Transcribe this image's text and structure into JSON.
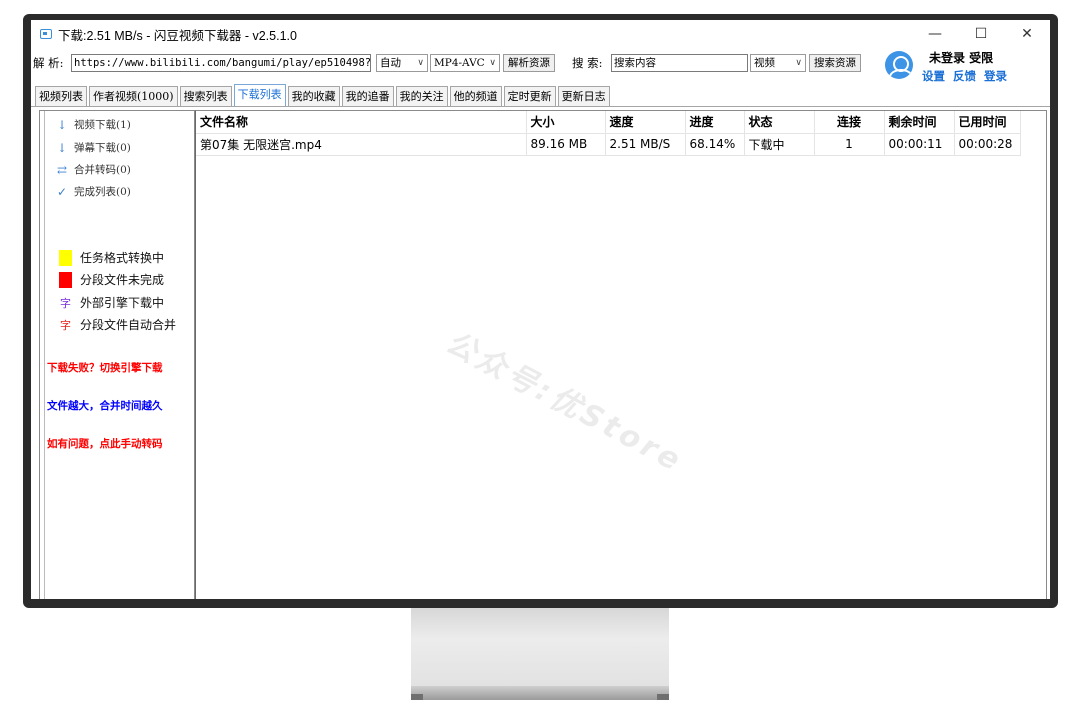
{
  "window": {
    "title": "下载:2.51 MB/s - 闪豆视频下载器 - v2.5.1.0",
    "minimize": "—",
    "maximize": "☐",
    "close": "✕"
  },
  "parse_bar": {
    "label": "解 析:",
    "url_value": "https://www.bilibili.com/bangumi/play/ep510498?fr",
    "mode_select": "自动",
    "format_select": "MP4-AVC",
    "parse_button": "解析资源",
    "search_label": "搜 索:",
    "search_placeholder": "搜索内容",
    "search_type_select": "视频",
    "search_button": "搜索资源"
  },
  "user": {
    "status": "未登录 受限",
    "links": [
      "设置",
      "反馈",
      "登录"
    ]
  },
  "tabs": [
    "视频列表",
    "作者视频(1000)",
    "搜索列表",
    "下载列表",
    "我的收藏",
    "我的追番",
    "我的关注",
    "他的频道",
    "定时更新",
    "更新日志"
  ],
  "active_tab": "下载列表",
  "sidebar": {
    "items": [
      {
        "icon": "↓",
        "label": "视频下载(1)"
      },
      {
        "icon": "↓",
        "label": "弹幕下载(0)"
      },
      {
        "icon": "⇄",
        "label": "合并转码(0)"
      },
      {
        "icon": "✓",
        "label": "完成列表(0)"
      }
    ],
    "legend": [
      {
        "color": "#ffff00",
        "label": "任务格式转换中"
      },
      {
        "color": "#ff0000",
        "label": "分段文件未完成"
      },
      {
        "glyph": "字",
        "glyph_color": "#7a2fd6",
        "label": "外部引擎下载中"
      },
      {
        "glyph": "字",
        "glyph_color": "#e02020",
        "label": "分段文件自动合并"
      }
    ],
    "notices": [
      {
        "text": "下载失败？切换引擎下载",
        "color": "#ff0000"
      },
      {
        "text": "文件越大，合并时间越久",
        "color": "#0000ff"
      },
      {
        "text": "如有问题，点此手动转码",
        "color": "#ff0000"
      }
    ]
  },
  "table": {
    "headers": [
      "文件名称",
      "大小",
      "速度",
      "进度",
      "状态",
      "连接",
      "剩余时间",
      "已用时间"
    ],
    "rows": [
      [
        "第07集 无限迷宫.mp4",
        "89.16 MB",
        "2.51 MB/S",
        "68.14%",
        "下载中",
        "1",
        "00:00:11",
        "00:00:28"
      ]
    ]
  },
  "watermark": "公众号:优Store"
}
